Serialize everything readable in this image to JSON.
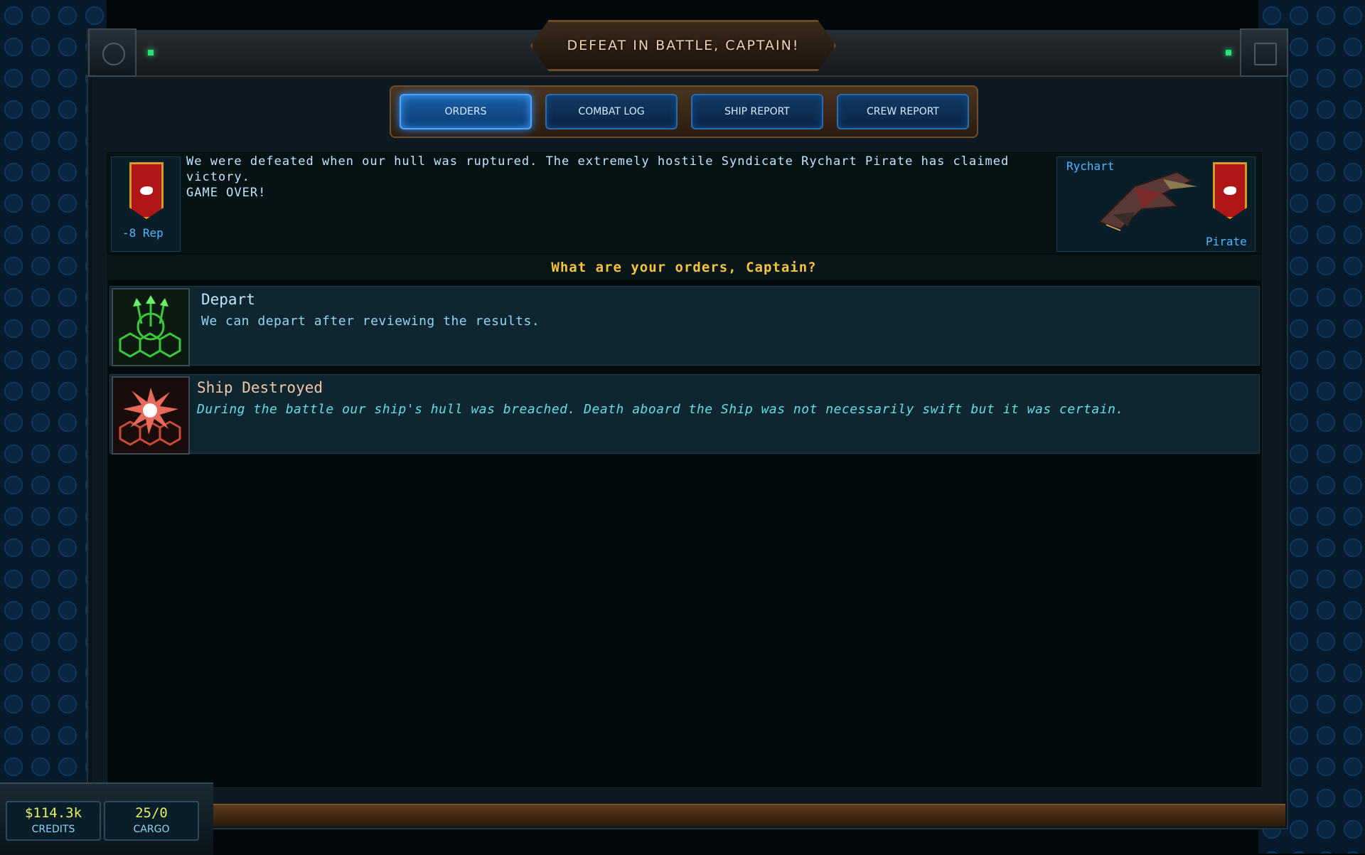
{
  "title": "DEFEAT IN BATTLE, CAPTAIN!",
  "tabs": [
    {
      "label": "ORDERS",
      "active": true
    },
    {
      "label": "COMBAT LOG",
      "active": false
    },
    {
      "label": "SHIP REPORT",
      "active": false
    },
    {
      "label": "CREW REPORT",
      "active": false
    }
  ],
  "encounter": {
    "player_rep": "-8 Rep",
    "message_line1": "We were defeated when our hull was ruptured. The extremely hostile Syndicate Rychart Pirate has claimed victory.",
    "message_line2": "GAME OVER!",
    "enemy_name": "Rychart",
    "enemy_type": "Pirate"
  },
  "prompt": "What are your orders, Captain?",
  "options": [
    {
      "title": "Depart",
      "description": "We can depart after reviewing the results.",
      "icon": "depart-icon",
      "color": "#bfe6ff",
      "desc_color": "#8fd6f5"
    },
    {
      "title": "Ship Destroyed",
      "description": "During the battle our ship's hull was breached. Death aboard the Ship was not necessarily swift but it was certain.",
      "icon": "explosion-icon",
      "color": "#f0c8a8",
      "desc_color": "#5ee0e8"
    }
  ],
  "footer": {
    "credits_value": "$114.3k",
    "credits_label": "CREDITS",
    "cargo_value": "25/0",
    "cargo_label": "CARGO"
  },
  "colors": {
    "accent_blue": "#4fa6ff",
    "prompt_gold": "#f2c440",
    "faction_red": "#b01616"
  }
}
